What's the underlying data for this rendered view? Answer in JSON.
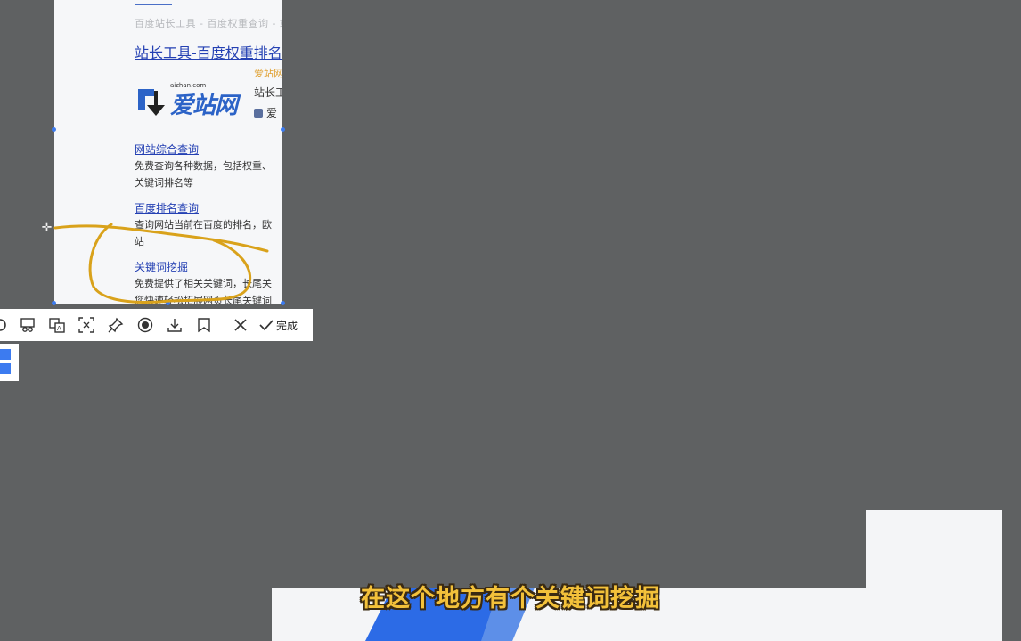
{
  "capture": {
    "faded_line": "百度站长工具 - 百度权重查询 - 站长工具",
    "result_title": "站长工具-百度权重排名",
    "logo_url": "aizhan.com",
    "logo_name": "爱站网",
    "site_name": "爱站网",
    "site_desc": "站长工",
    "site_author": "爱",
    "items": [
      {
        "title": "网站综合查询",
        "desc_lines": [
          "免费查询各种数据，包括权重、",
          "关键词排名等"
        ]
      },
      {
        "title": "百度排名查询",
        "desc_lines": [
          "查询网站当前在百度的排名，欧",
          "站"
        ]
      },
      {
        "title": "关键词挖掘",
        "desc_lines": [
          "免费提供了相关关键词，长尾关",
          "您快速轻松拓展网页长尾关键词"
        ]
      }
    ]
  },
  "toolbar": {
    "icons": [
      "shape-icon",
      "scissors-icon",
      "translate-icon",
      "ocr-icon",
      "pin-icon",
      "record-icon",
      "download-icon",
      "bookmark-icon",
      "close-icon"
    ],
    "done_label": "完成"
  },
  "colors": {
    "background": "#5f6162",
    "accent": "#3c7bf0",
    "pen": "#d9a21b",
    "subtitle": "#f3c13a"
  },
  "subtitle": "在这个地方有个关键词挖掘"
}
